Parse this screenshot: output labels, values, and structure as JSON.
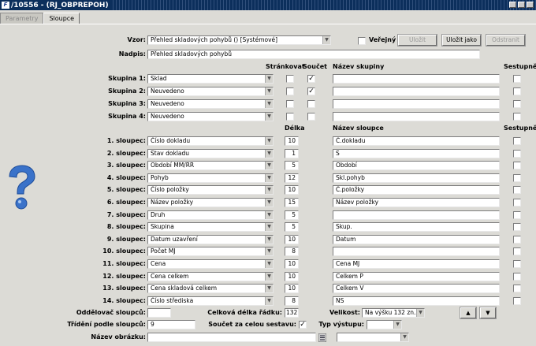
{
  "window": {
    "title": "/10556 - (RJ_OBPREPOH)",
    "app_icon": "oracle-forms-icon"
  },
  "tabs": [
    {
      "label": "Parametry",
      "active": false
    },
    {
      "label": "Sloupce",
      "active": true
    }
  ],
  "top": {
    "vzor_label": "Vzor:",
    "vzor_value": "Přehled skladových pohybů   ()   [Systémové]",
    "verejny_label": "Veřejný",
    "verejny_checked": false,
    "ulozit_label": "Uložit",
    "ulozit_jako_label": "Uložit jako",
    "odstranit_label": "Odstranit",
    "nadpis_label": "Nadpis:",
    "nadpis_value": "Přehled skladových pohybů"
  },
  "group_headers": {
    "strankovat": "Stránkovat",
    "soucet": "Součet",
    "nazev_skupiny": "Název skupiny",
    "sestupne": "Sestupně"
  },
  "groups": [
    {
      "label": "Skupina 1:",
      "value": "Sklad",
      "strankovat": false,
      "soucet": true,
      "nazev": "",
      "sestupne": false
    },
    {
      "label": "Skupina 2:",
      "value": "Neuvedeno",
      "strankovat": false,
      "soucet": true,
      "nazev": "",
      "sestupne": false
    },
    {
      "label": "Skupina 3:",
      "value": "Neuvedeno",
      "strankovat": false,
      "soucet": false,
      "nazev": "",
      "sestupne": false
    },
    {
      "label": "Skupina 4:",
      "value": "Neuvedeno",
      "strankovat": false,
      "soucet": false,
      "nazev": "",
      "sestupne": false
    }
  ],
  "column_headers": {
    "delka": "Délka",
    "nazev_sloupce": "Název sloupce",
    "sestupne": "Sestupně"
  },
  "columns": [
    {
      "label": "1. sloupec:",
      "value": "Číslo dokladu",
      "delka": "10",
      "nazev": "Č.dokladu"
    },
    {
      "label": "2. sloupec:",
      "value": "Stav dokladu",
      "delka": "1",
      "nazev": "S"
    },
    {
      "label": "3. sloupec:",
      "value": "Období MM/RR",
      "delka": "5",
      "nazev": "Období"
    },
    {
      "label": "4. sloupec:",
      "value": "Pohyb",
      "delka": "12",
      "nazev": "Skl.pohyb"
    },
    {
      "label": "5. sloupec:",
      "value": "Číslo položky",
      "delka": "10",
      "nazev": "Č.položky"
    },
    {
      "label": "6. sloupec:",
      "value": "Název položky",
      "delka": "15",
      "nazev": "Název položky"
    },
    {
      "label": "7. sloupec:",
      "value": "Druh",
      "delka": "5",
      "nazev": ""
    },
    {
      "label": "8. sloupec:",
      "value": "Skupina",
      "delka": "5",
      "nazev": "Skup."
    },
    {
      "label": "9. sloupec:",
      "value": "Datum uzavření",
      "delka": "10",
      "nazev": "Datum"
    },
    {
      "label": "10. sloupec:",
      "value": "Počet MJ",
      "delka": "8",
      "nazev": ""
    },
    {
      "label": "11. sloupec:",
      "value": "Cena",
      "delka": "10",
      "nazev": "Cena MJ"
    },
    {
      "label": "12. sloupec:",
      "value": "Cena celkem",
      "delka": "10",
      "nazev": "Celkem P"
    },
    {
      "label": "13. sloupec:",
      "value": "Cena skladová celkem",
      "delka": "10",
      "nazev": "Celkem V"
    },
    {
      "label": "14. sloupec:",
      "value": "Číslo střediska",
      "delka": "8",
      "nazev": "NS"
    }
  ],
  "bottom": {
    "oddelovac_label": "Oddělovač sloupců:",
    "oddelovac_value": "",
    "celkova_label": "Celková délka řádku:",
    "celkova_value": "132",
    "velikost_label": "Velikost:",
    "velikost_value": "Na výšku 132 zn.",
    "trideni_label": "Třídění podle sloupců:",
    "trideni_value": "9",
    "soucet_sestavy_label": "Součet za celou sestavu:",
    "soucet_sestavy_checked": true,
    "typ_vystupu_label": "Typ výstupu:",
    "typ_vystupu_value": "",
    "nazev_obrazku_label": "Název obrázku:",
    "nazev_obrazku_value": "",
    "extra_combo_value": ""
  },
  "icons": {
    "help": "help-question-icon",
    "list": "list-picker-icon",
    "up": "arrow-up-icon",
    "down": "arrow-down-icon"
  }
}
